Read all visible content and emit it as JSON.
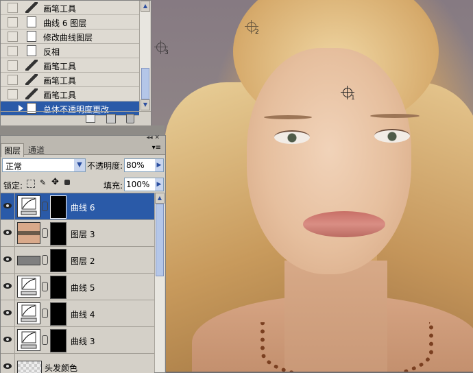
{
  "history": {
    "items": [
      {
        "label": "画笔工具",
        "icon": "brush-icon",
        "selected": false
      },
      {
        "label": "曲线 6 图层",
        "icon": "document-icon",
        "selected": false
      },
      {
        "label": "修改曲线图层",
        "icon": "document-icon",
        "selected": false
      },
      {
        "label": "反相",
        "icon": "document-icon",
        "selected": false
      },
      {
        "label": "画笔工具",
        "icon": "brush-icon",
        "selected": false
      },
      {
        "label": "画笔工具",
        "icon": "brush-icon",
        "selected": false
      },
      {
        "label": "画笔工具",
        "icon": "brush-icon",
        "selected": false
      },
      {
        "label": "总体不透明度更改",
        "icon": "document-icon",
        "selected": true
      }
    ]
  },
  "layers_panel": {
    "tabs": [
      "图层",
      "通道"
    ],
    "blend_mode": "正常",
    "opacity_label": "不透明度:",
    "opacity_value": "80%",
    "lock_label": "锁定:",
    "fill_label": "填充:",
    "fill_value": "100%",
    "layers": [
      {
        "name": "曲线 6",
        "type": "curves",
        "selected": true
      },
      {
        "name": "图层 3",
        "type": "eyes",
        "selected": false
      },
      {
        "name": "图层 2",
        "type": "gray",
        "selected": false
      },
      {
        "name": "曲线 5",
        "type": "curves",
        "selected": false
      },
      {
        "name": "曲线 4",
        "type": "curves",
        "selected": false
      },
      {
        "name": "曲线 3",
        "type": "curves",
        "selected": false
      },
      {
        "name": "头发颜色",
        "type": "checker",
        "selected": false
      }
    ]
  },
  "canvas": {
    "markers": [
      "1",
      "2",
      "3"
    ]
  }
}
